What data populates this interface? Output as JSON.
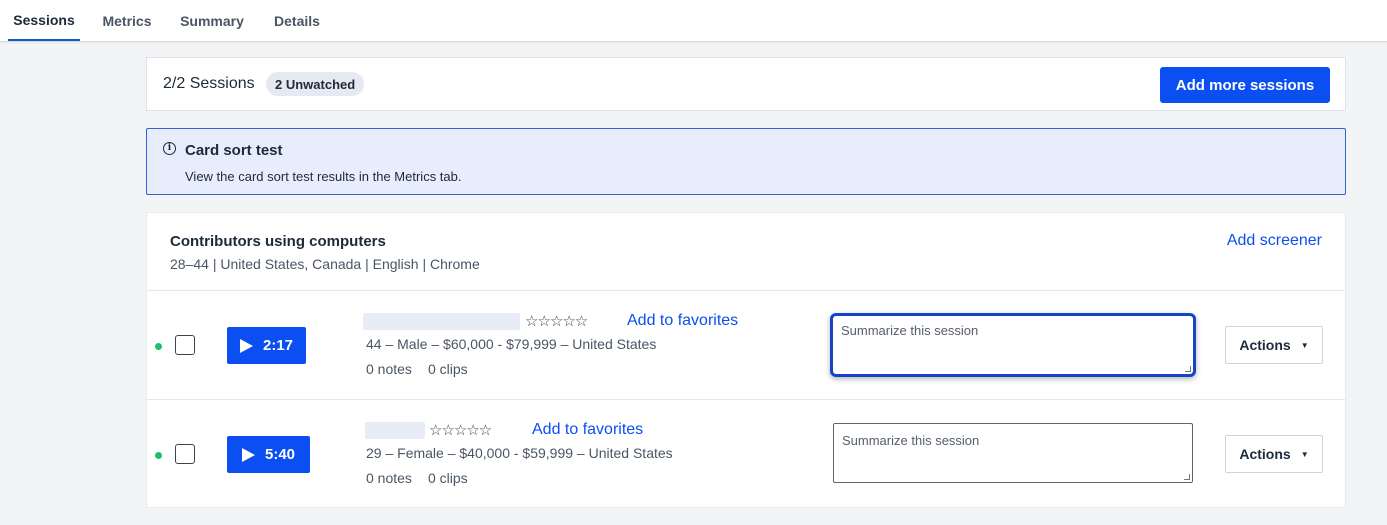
{
  "tabs": [
    {
      "label": "Sessions",
      "active": true
    },
    {
      "label": "Metrics",
      "active": false
    },
    {
      "label": "Summary",
      "active": false
    },
    {
      "label": "Details",
      "active": false
    }
  ],
  "session_header": {
    "count_text": "2/2 Sessions",
    "unwatched_badge": "2 Unwatched",
    "add_button_label": "Add more sessions"
  },
  "info_banner": {
    "icon": "info-icon",
    "title": "Card sort test",
    "text": "View the card sort test results in the Metrics tab."
  },
  "group": {
    "title": "Contributors using computers",
    "subtitle": "28–44 | United States, Canada | English | Chrome",
    "add_screener_label": "Add screener"
  },
  "sessions": [
    {
      "duration": "2:17",
      "stars": "☆☆☆☆☆",
      "favorite_label": "Add to favorites",
      "demographics": "44 – Male – $60,000 - $79,999 – United States",
      "notes": "0 notes",
      "clips": "0 clips",
      "summary_placeholder": "Summarize this session",
      "actions_label": "Actions",
      "status_color": "#1dbf6b"
    },
    {
      "duration": "5:40",
      "stars": "☆☆☆☆☆",
      "favorite_label": "Add to favorites",
      "demographics": "29 – Female – $40,000 - $59,999 – United States",
      "notes": "0 notes",
      "clips": "0 clips",
      "summary_placeholder": "Summarize this session",
      "actions_label": "Actions",
      "status_color": "#1dbf6b"
    }
  ],
  "colors": {
    "accent": "#0b4ff3",
    "banner_bg": "#e8edfc",
    "page_bg": "#f2f4f5"
  }
}
